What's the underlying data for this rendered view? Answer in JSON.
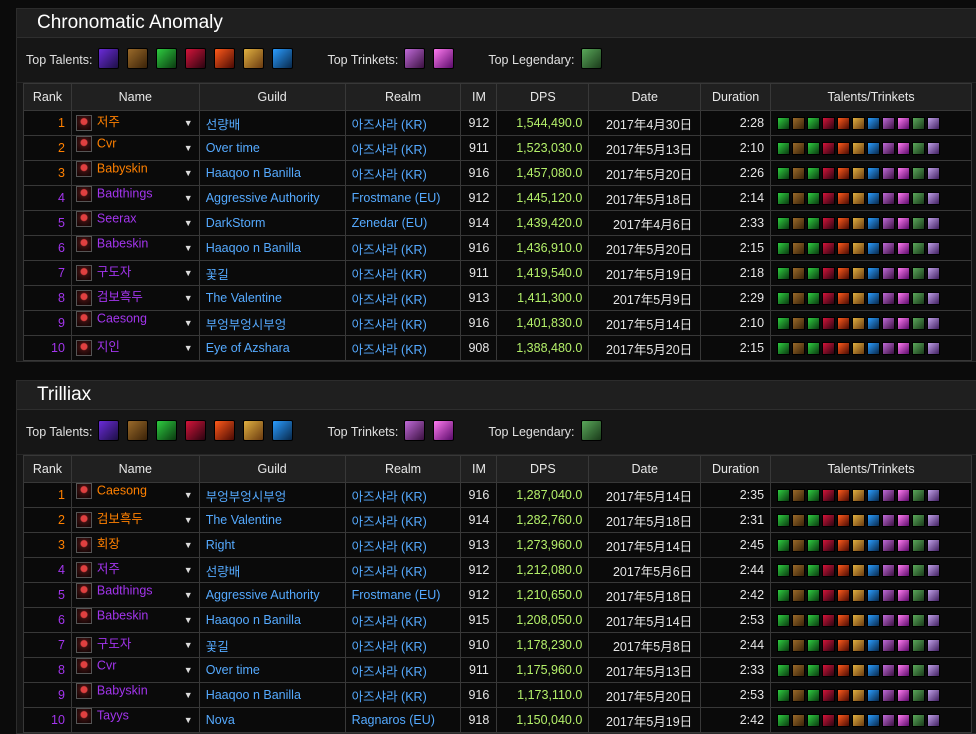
{
  "colors": {
    "dps": "#b4f06a",
    "link": "#55aaff",
    "legendary": "#ff8000",
    "epic": "#a335ee",
    "rare": "#4a8cff",
    "uncommon": "#1eff00"
  },
  "labels": {
    "top_talents": "Top Talents:",
    "top_trinkets": "Top Trinkets:",
    "top_legendary": "Top Legendary:"
  },
  "columns": [
    "Rank",
    "Name",
    "Guild",
    "Realm",
    "IM",
    "DPS",
    "Date",
    "Duration",
    "Talents/Trinkets"
  ],
  "top_icons": {
    "talents": [
      "void-talent-icon",
      "bronze-talent-icon",
      "nature-talent-icon",
      "shadow-demon-talent-icon",
      "fire-talent-icon",
      "tome-talent-icon",
      "arcane-swirl-talent-icon"
    ],
    "trinkets": [
      "feather-trinket-icon",
      "pink-flame-trinket-icon"
    ],
    "legendary": [
      "green-orb-legendary-icon"
    ]
  },
  "sections": [
    {
      "title": "Chronomatic Anomaly",
      "rows": [
        {
          "rank": "1",
          "q": "q-leg",
          "name": "저주",
          "guild": "선량배",
          "realm": "아즈샤라 (KR)",
          "im": "912",
          "dps": "1,544,490.0",
          "date": "2017年4月30日",
          "duration": "2:28"
        },
        {
          "rank": "2",
          "q": "q-leg",
          "name": "Cvr",
          "guild": "Over time",
          "realm": "아즈샤라 (KR)",
          "im": "911",
          "dps": "1,523,030.0",
          "date": "2017年5月13日",
          "duration": "2:10"
        },
        {
          "rank": "3",
          "q": "q-leg",
          "name": "Babyskin",
          "guild": "Haaqoo n Banilla",
          "realm": "아즈샤라 (KR)",
          "im": "916",
          "dps": "1,457,080.0",
          "date": "2017年5月20日",
          "duration": "2:26"
        },
        {
          "rank": "4",
          "q": "q-epic",
          "name": "Badthings",
          "guild": "Aggressive Authority",
          "realm": "Frostmane (EU)",
          "im": "912",
          "dps": "1,445,120.0",
          "date": "2017年5月18日",
          "duration": "2:14"
        },
        {
          "rank": "5",
          "q": "q-epic",
          "name": "Seerax",
          "guild": "DarkStorm",
          "realm": "Zenedar (EU)",
          "im": "914",
          "dps": "1,439,420.0",
          "date": "2017年4月6日",
          "duration": "2:33"
        },
        {
          "rank": "6",
          "q": "q-epic",
          "name": "Babeskin",
          "guild": "Haaqoo n Banilla",
          "realm": "아즈샤라 (KR)",
          "im": "916",
          "dps": "1,436,910.0",
          "date": "2017年5月20日",
          "duration": "2:15"
        },
        {
          "rank": "7",
          "q": "q-epic",
          "name": "구도자",
          "guild": "꽃길",
          "realm": "아즈샤라 (KR)",
          "im": "911",
          "dps": "1,419,540.0",
          "date": "2017年5月19日",
          "duration": "2:18"
        },
        {
          "rank": "8",
          "q": "q-epic",
          "name": "검보흑두",
          "guild": "The Valentine",
          "realm": "아즈샤라 (KR)",
          "im": "913",
          "dps": "1,411,300.0",
          "date": "2017年5月9日",
          "duration": "2:29"
        },
        {
          "rank": "9",
          "q": "q-epic",
          "name": "Caesong",
          "guild": "부엉부엉시부엉",
          "realm": "아즈샤라 (KR)",
          "im": "916",
          "dps": "1,401,830.0",
          "date": "2017年5月14日",
          "duration": "2:10"
        },
        {
          "rank": "10",
          "q": "q-epic",
          "name": "지인",
          "guild": "Eye of Azshara",
          "realm": "아즈샤라 (KR)",
          "im": "908",
          "dps": "1,388,480.0",
          "date": "2017年5月20日",
          "duration": "2:15"
        }
      ]
    },
    {
      "title": "Trilliax",
      "rows": [
        {
          "rank": "1",
          "q": "q-leg",
          "name": "Caesong",
          "guild": "부엉부엉시부엉",
          "realm": "아즈샤라 (KR)",
          "im": "916",
          "dps": "1,287,040.0",
          "date": "2017年5月14日",
          "duration": "2:35"
        },
        {
          "rank": "2",
          "q": "q-leg",
          "name": "검보흑두",
          "guild": "The Valentine",
          "realm": "아즈샤라 (KR)",
          "im": "914",
          "dps": "1,282,760.0",
          "date": "2017年5月18日",
          "duration": "2:31"
        },
        {
          "rank": "3",
          "q": "q-leg",
          "name": "회장",
          "guild": "Right",
          "realm": "아즈샤라 (KR)",
          "im": "913",
          "dps": "1,273,960.0",
          "date": "2017年5月14日",
          "duration": "2:45"
        },
        {
          "rank": "4",
          "q": "q-epic",
          "name": "저주",
          "guild": "선량배",
          "realm": "아즈샤라 (KR)",
          "im": "912",
          "dps": "1,212,080.0",
          "date": "2017年5月6日",
          "duration": "2:44"
        },
        {
          "rank": "5",
          "q": "q-epic",
          "name": "Badthings",
          "guild": "Aggressive Authority",
          "realm": "Frostmane (EU)",
          "im": "912",
          "dps": "1,210,650.0",
          "date": "2017年5月18日",
          "duration": "2:42"
        },
        {
          "rank": "6",
          "q": "q-epic",
          "name": "Babeskin",
          "guild": "Haaqoo n Banilla",
          "realm": "아즈샤라 (KR)",
          "im": "915",
          "dps": "1,208,050.0",
          "date": "2017年5月14日",
          "duration": "2:53"
        },
        {
          "rank": "7",
          "q": "q-epic",
          "name": "구도자",
          "guild": "꽃길",
          "realm": "아즈샤라 (KR)",
          "im": "910",
          "dps": "1,178,230.0",
          "date": "2017年5月8日",
          "duration": "2:44"
        },
        {
          "rank": "8",
          "q": "q-epic",
          "name": "Cvr",
          "guild": "Over time",
          "realm": "아즈샤라 (KR)",
          "im": "911",
          "dps": "1,175,960.0",
          "date": "2017年5月13日",
          "duration": "2:33"
        },
        {
          "rank": "9",
          "q": "q-epic",
          "name": "Babyskin",
          "guild": "Haaqoo n Banilla",
          "realm": "아즈샤라 (KR)",
          "im": "916",
          "dps": "1,173,110.0",
          "date": "2017年5月20日",
          "duration": "2:53"
        },
        {
          "rank": "10",
          "q": "q-epic",
          "name": "Tayys",
          "guild": "Nova",
          "realm": "Ragnaros (EU)",
          "im": "918",
          "dps": "1,150,040.0",
          "date": "2017年5月19日",
          "duration": "2:42"
        }
      ]
    }
  ]
}
